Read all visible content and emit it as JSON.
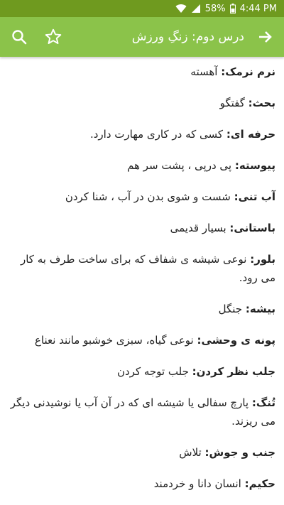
{
  "status": {
    "battery_percent": "58%",
    "time": "4:44 PM"
  },
  "header": {
    "title": "درس دوم: زنگِ ورزش"
  },
  "entries": [
    {
      "term": "نرم نرمک:",
      "definition": " آهسته"
    },
    {
      "term": "بحث:",
      "definition": " گفتگو"
    },
    {
      "term": "حرفه ای:",
      "definition": " کسی که در کاری مهارت دارد."
    },
    {
      "term": "پیوسته:",
      "definition": " پی درپی ، پشت سر هم"
    },
    {
      "term": "آب تنی:",
      "definition": " شست و شوی بدن در آب ، شنا کردن"
    },
    {
      "term": "باستانی:",
      "definition": " بسیار قدیمی"
    },
    {
      "term": "بلور:",
      "definition": " نوعی شیشه ی شفاف که برای ساخت طرف به کار می رود."
    },
    {
      "term": "بیشه:",
      "definition": " جنگل"
    },
    {
      "term": "پونه ی وحشی:",
      "definition": " نوعی گیاه، سبزی خوشبو مانند نعناع"
    },
    {
      "term": "جلب نظر کردن:",
      "definition": " جلب توجه کردن"
    },
    {
      "term": "تُنگ:",
      "definition": " پارچ سفالی یا شیشه ای که در آن آب یا نوشیدنی دیگر می ریزند."
    },
    {
      "term": "جنب و جوش:",
      "definition": " تلاش"
    },
    {
      "term": "حکیم:",
      "definition": " انسان دانا و خردمند"
    }
  ]
}
